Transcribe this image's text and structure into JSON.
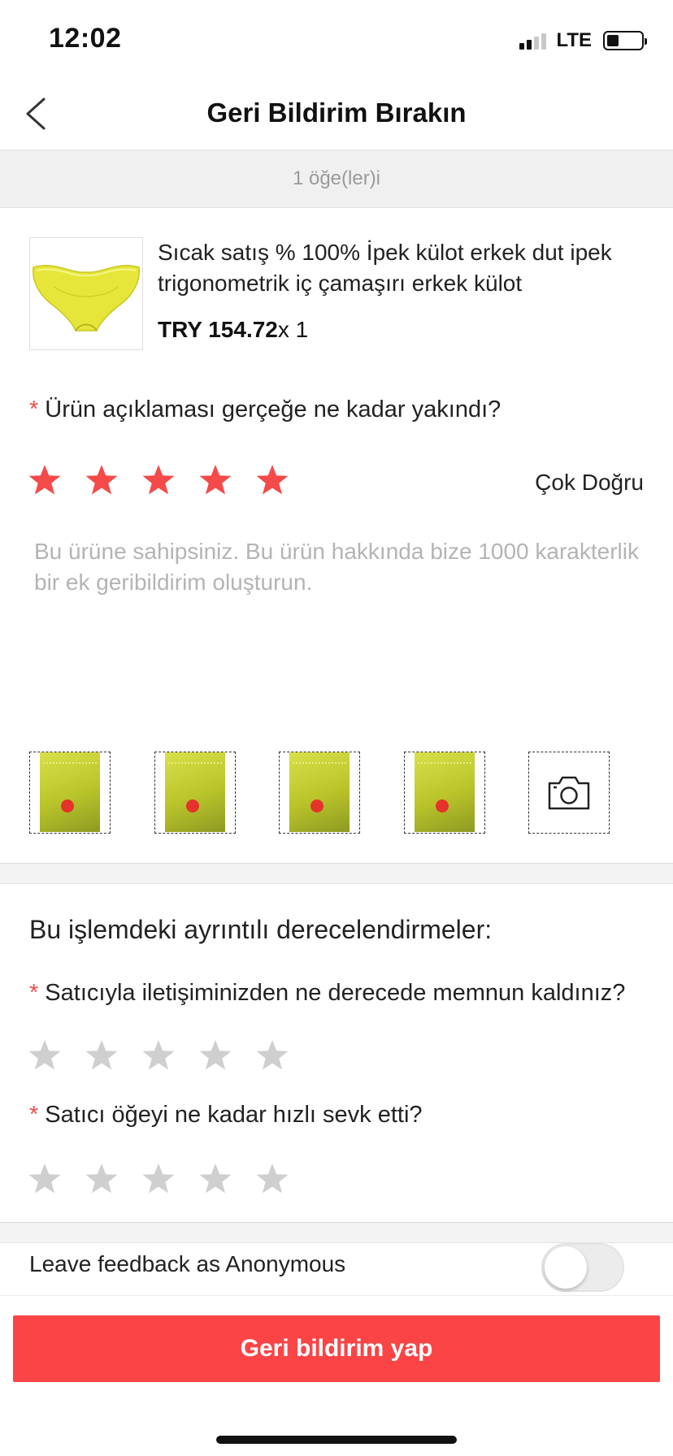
{
  "status_bar": {
    "time": "12:02",
    "network": "LTE"
  },
  "header": {
    "title": "Geri Bildirim Bırakın"
  },
  "items_count": "1 öğe(ler)i",
  "product": {
    "title": "Sıcak satış % 100% İpek külot erkek dut ipek trigonometrik iç çamaşırı erkek külot",
    "price": "TRY 154.72",
    "quantity": "x 1"
  },
  "description_rating": {
    "required_mark": "*",
    "question": "Ürün açıklaması gerçeğe ne kadar yakındı?",
    "stars_selected": 5,
    "stars_total": 5,
    "rating_label": "Çok Doğru"
  },
  "feedback": {
    "placeholder": "Bu ürüne sahipsiniz. Bu ürün hakkında bize 1000 karakterlik bir ek geribildirim oluşturun."
  },
  "photos": {
    "count": 4,
    "camera_icon": "camera-icon"
  },
  "detailed_ratings": {
    "title": "Bu işlemdeki ayrıntılı derecelendirmeler:",
    "communication": {
      "required_mark": "*",
      "question": "Satıcıyla iletişiminizden ne derecede memnun kaldınız?",
      "stars_selected": 0
    },
    "shipping": {
      "required_mark": "*",
      "question": "Satıcı öğeyi ne kadar hızlı sevk etti?",
      "stars_selected": 0
    }
  },
  "anonymous": {
    "label": "Leave feedback as Anonymous",
    "enabled": false
  },
  "submit": {
    "label": "Geri bildirim yap"
  },
  "colors": {
    "accent": "#fa4446",
    "star_active": "#f54a4a",
    "star_inactive": "#cfcfcf"
  }
}
